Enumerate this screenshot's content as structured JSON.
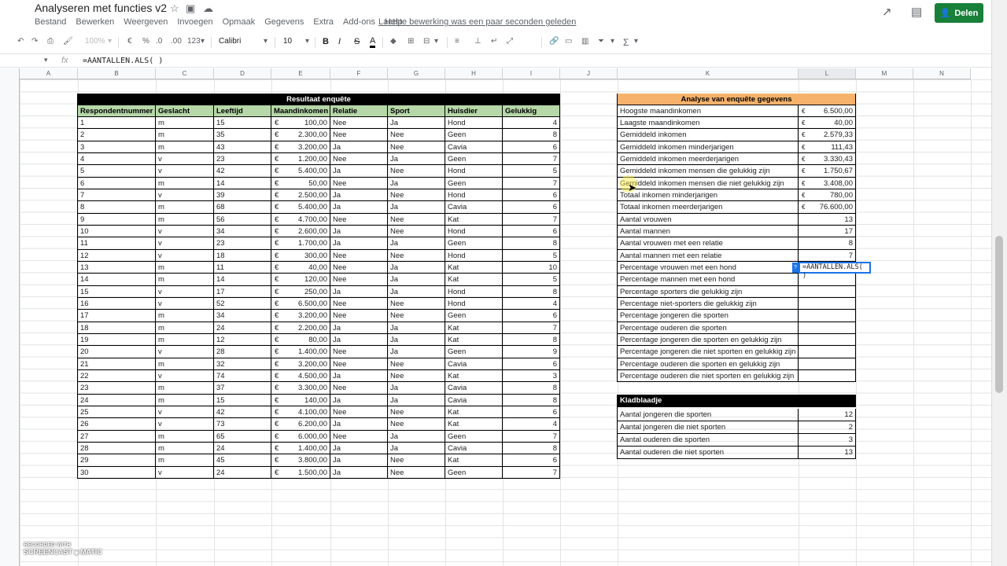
{
  "doc": {
    "title": "Analyseren met functies v2",
    "last_edit": "Laatste bewerking was een paar seconden geleden",
    "share_label": "Delen",
    "menu": [
      "Bestand",
      "Bewerken",
      "Weergeven",
      "Invoegen",
      "Opmaak",
      "Gegevens",
      "Extra",
      "Add-ons",
      "Help"
    ]
  },
  "toolbar": {
    "zoom": "100%",
    "currency": "€",
    "percent": "%",
    "dec_less": ".0",
    "dec_more": ".00",
    "format": "123",
    "font": "Calibri",
    "size": "10",
    "bold": "B",
    "italic": "I",
    "strike": "S",
    "textcolor": "A",
    "sum": "Σ"
  },
  "formula_bar": {
    "fx": "fx",
    "formula": "=AANTALLEN.ALS( )"
  },
  "columns": [
    "A",
    "B",
    "C",
    "D",
    "E",
    "F",
    "G",
    "H",
    "I",
    "J",
    "K",
    "L",
    "M",
    "N"
  ],
  "table": {
    "title": "Resultaat enquête",
    "headers": [
      "Respondentnummer",
      "Geslacht",
      "Leeftijd",
      "Maandinkomen",
      "Relatie",
      "Sport",
      "Huisdier",
      "Gelukkig"
    ],
    "rows": [
      [
        "1",
        "m",
        "15",
        "100,00",
        "Nee",
        "Ja",
        "Hond",
        "4"
      ],
      [
        "2",
        "m",
        "35",
        "2.300,00",
        "Nee",
        "Nee",
        "Geen",
        "8"
      ],
      [
        "3",
        "m",
        "43",
        "3.200,00",
        "Ja",
        "Nee",
        "Cavia",
        "6"
      ],
      [
        "4",
        "v",
        "23",
        "1.200,00",
        "Nee",
        "Ja",
        "Geen",
        "7"
      ],
      [
        "5",
        "v",
        "42",
        "5.400,00",
        "Ja",
        "Nee",
        "Hond",
        "5"
      ],
      [
        "6",
        "m",
        "14",
        "50,00",
        "Nee",
        "Ja",
        "Geen",
        "7"
      ],
      [
        "7",
        "v",
        "39",
        "2.500,00",
        "Ja",
        "Nee",
        "Hond",
        "6"
      ],
      [
        "8",
        "m",
        "68",
        "5.400,00",
        "Ja",
        "Ja",
        "Cavia",
        "6"
      ],
      [
        "9",
        "m",
        "56",
        "4.700,00",
        "Nee",
        "Nee",
        "Kat",
        "7"
      ],
      [
        "10",
        "v",
        "34",
        "2.600,00",
        "Ja",
        "Nee",
        "Hond",
        "6"
      ],
      [
        "11",
        "v",
        "23",
        "1.700,00",
        "Ja",
        "Ja",
        "Geen",
        "8"
      ],
      [
        "12",
        "v",
        "18",
        "300,00",
        "Nee",
        "Nee",
        "Hond",
        "5"
      ],
      [
        "13",
        "m",
        "11",
        "40,00",
        "Nee",
        "Ja",
        "Kat",
        "10"
      ],
      [
        "14",
        "m",
        "14",
        "120,00",
        "Nee",
        "Ja",
        "Kat",
        "5"
      ],
      [
        "15",
        "v",
        "17",
        "250,00",
        "Ja",
        "Ja",
        "Hond",
        "8"
      ],
      [
        "16",
        "v",
        "52",
        "6.500,00",
        "Nee",
        "Nee",
        "Hond",
        "4"
      ],
      [
        "17",
        "m",
        "34",
        "3.200,00",
        "Nee",
        "Nee",
        "Geen",
        "6"
      ],
      [
        "18",
        "m",
        "24",
        "2.200,00",
        "Ja",
        "Ja",
        "Kat",
        "7"
      ],
      [
        "19",
        "m",
        "12",
        "80,00",
        "Ja",
        "Ja",
        "Kat",
        "8"
      ],
      [
        "20",
        "v",
        "28",
        "1.400,00",
        "Nee",
        "Ja",
        "Geen",
        "9"
      ],
      [
        "21",
        "m",
        "32",
        "3.200,00",
        "Nee",
        "Nee",
        "Cavia",
        "6"
      ],
      [
        "22",
        "v",
        "74",
        "4.500,00",
        "Ja",
        "Nee",
        "Kat",
        "3"
      ],
      [
        "23",
        "m",
        "37",
        "3.300,00",
        "Nee",
        "Ja",
        "Cavia",
        "8"
      ],
      [
        "24",
        "m",
        "15",
        "140,00",
        "Ja",
        "Ja",
        "Cavia",
        "8"
      ],
      [
        "25",
        "v",
        "42",
        "4.100,00",
        "Nee",
        "Nee",
        "Kat",
        "6"
      ],
      [
        "26",
        "v",
        "73",
        "6.200,00",
        "Ja",
        "Nee",
        "Kat",
        "4"
      ],
      [
        "27",
        "m",
        "65",
        "6.000,00",
        "Nee",
        "Ja",
        "Geen",
        "7"
      ],
      [
        "28",
        "m",
        "24",
        "1.400,00",
        "Ja",
        "Ja",
        "Cavia",
        "8"
      ],
      [
        "29",
        "m",
        "45",
        "3.800,00",
        "Ja",
        "Nee",
        "Kat",
        "6"
      ],
      [
        "30",
        "v",
        "24",
        "1.500,00",
        "Ja",
        "Nee",
        "Geen",
        "7"
      ]
    ]
  },
  "analysis": {
    "title": "Analyse van enquête gegevens",
    "rows": [
      [
        "Hoogste maandinkomen",
        "€",
        "6.500,00"
      ],
      [
        "Laagste maandinkomen",
        "€",
        "40,00"
      ],
      [
        "Gemiddeld inkomen",
        "€",
        "2.579,33"
      ],
      [
        "Gemiddeld inkomen minderjarigen",
        "€",
        "111,43"
      ],
      [
        "Gemiddeld inkomen meerderjarigen",
        "€",
        "3.330,43"
      ],
      [
        "Gemiddeld inkomen mensen die gelukkig zijn",
        "€",
        "1.750,67"
      ],
      [
        "Gemiddeld inkomen mensen die niet gelukkig zijn",
        "€",
        "3.408,00"
      ],
      [
        "Totaal inkomen minderjarigen",
        "€",
        "780,00"
      ],
      [
        "Totaal inkomen meerderjarigen",
        "€",
        "76.600,00"
      ],
      [
        "Aantal vrouwen",
        "",
        "13"
      ],
      [
        "Aantal mannen",
        "",
        "17"
      ],
      [
        "Aantal vrouwen met een relatie",
        "",
        "8"
      ],
      [
        "Aantal mannen met een relatie",
        "",
        "7"
      ],
      [
        "Percentage vrouwen met een hond",
        "",
        ""
      ],
      [
        "Percentage mannen met een hond",
        "",
        ""
      ],
      [
        "Percentage sporters die gelukkig zijn",
        "",
        ""
      ],
      [
        "Percentage niet-sporters die gelukkig zijn",
        "",
        ""
      ],
      [
        "Percentage jongeren die sporten",
        "",
        ""
      ],
      [
        "Percentage ouderen die sporten",
        "",
        ""
      ],
      [
        "Percentage jongeren die sporten en gelukkig zijn",
        "",
        ""
      ],
      [
        "Percentage jongeren die niet sporten en gelukkig zijn",
        "",
        ""
      ],
      [
        "Percentage ouderen die sporten en gelukkig zijn",
        "",
        ""
      ],
      [
        "Percentage ouderen die niet sporten en gelukkig zijn",
        "",
        ""
      ]
    ]
  },
  "kladblaadje": {
    "title": "Kladblaadje",
    "rows": [
      [
        "Aantal jongeren die sporten",
        "12"
      ],
      [
        "Aantal jongeren die niet sporten",
        "2"
      ],
      [
        "Aantal ouderen die sporten",
        "3"
      ],
      [
        "Aantal ouderen die niet sporten",
        "13"
      ]
    ]
  },
  "editor": {
    "tag": "?",
    "value": "=AANTALLEN.ALS( )"
  },
  "watermark": {
    "line1": "RECORDED WITH",
    "line2": "SCREENCAST",
    "line3": "MATIC"
  }
}
